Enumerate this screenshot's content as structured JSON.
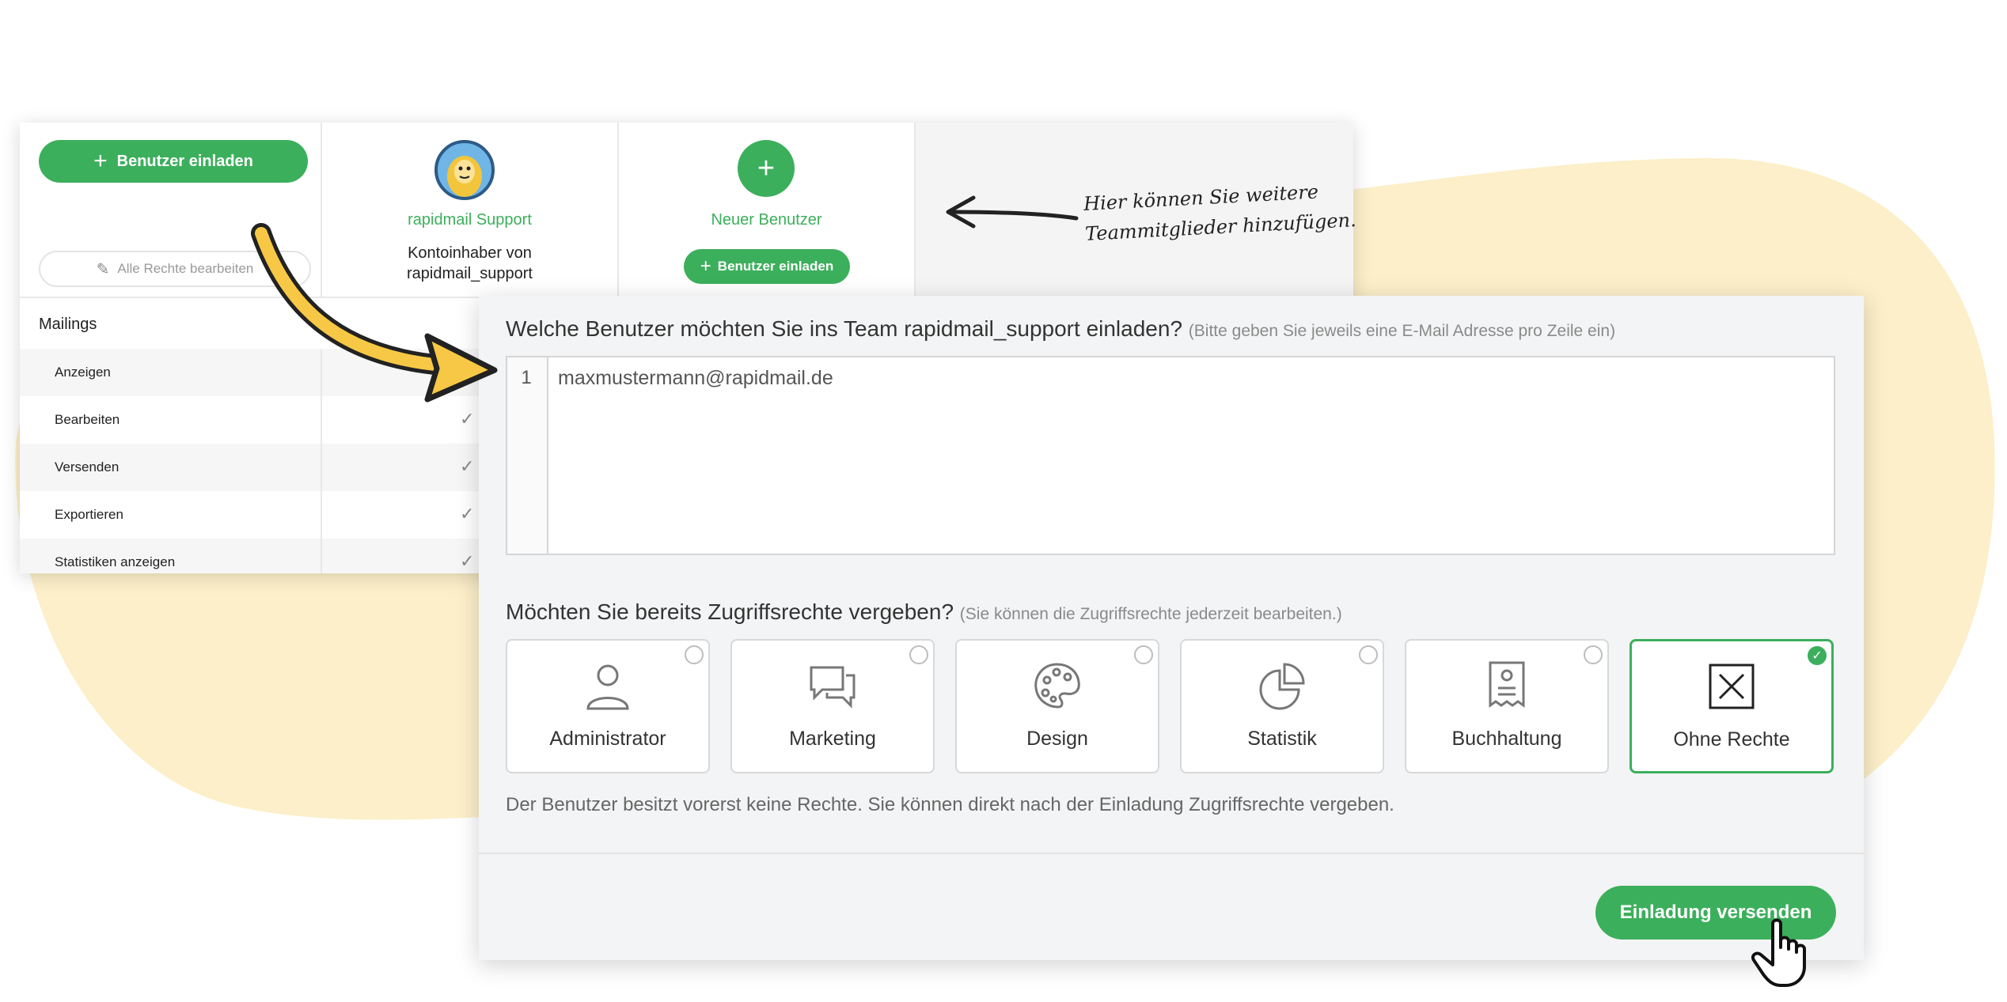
{
  "colors": {
    "accent": "#3caf5c",
    "blob": "#fcefc9",
    "arrow_yellow": "#f7c845"
  },
  "team_table": {
    "invite_button_label": "Benutzer einladen",
    "edit_all_rights_label": "Alle Rechte bearbeiten",
    "members": [
      {
        "name": "rapidmail Support",
        "description_line1": "Kontoinhaber von",
        "description_line2": "rapidmail_support"
      },
      {
        "name": "Neuer Benutzer",
        "invite_label": "Benutzer einladen"
      }
    ],
    "section": "Mailings",
    "permissions": [
      "Anzeigen",
      "Bearbeiten",
      "Versenden",
      "Exportieren",
      "Statistiken anzeigen"
    ]
  },
  "annotation": {
    "line1": "Hier können Sie weitere",
    "line2": "Teammitglieder hinzufügen."
  },
  "invite_dialog": {
    "question": "Welche Benutzer möchten Sie ins Team rapidmail_support einladen?",
    "question_hint": "(Bitte geben Sie jeweils eine E-Mail Adresse pro Zeile ein)",
    "line_number": "1",
    "email_value": "maxmustermann@rapidmail.de",
    "rights_question": "Möchten Sie bereits Zugriffsrechte vergeben?",
    "rights_hint": "(Sie können die Zugriffsrechte jederzeit bearbeiten.)",
    "roles": [
      {
        "label": "Administrator",
        "icon": "person-icon",
        "selected": false
      },
      {
        "label": "Marketing",
        "icon": "chat-bubbles-icon",
        "selected": false
      },
      {
        "label": "Design",
        "icon": "palette-icon",
        "selected": false
      },
      {
        "label": "Statistik",
        "icon": "pie-chart-icon",
        "selected": false
      },
      {
        "label": "Buchhaltung",
        "icon": "receipt-icon",
        "selected": false
      },
      {
        "label": "Ohne Rechte",
        "icon": "x-box-icon",
        "selected": true
      }
    ],
    "info_text": "Der Benutzer besitzt vorerst keine Rechte. Sie können direkt nach der Einladung Zugriffsrechte vergeben.",
    "send_button_label": "Einladung versenden"
  }
}
